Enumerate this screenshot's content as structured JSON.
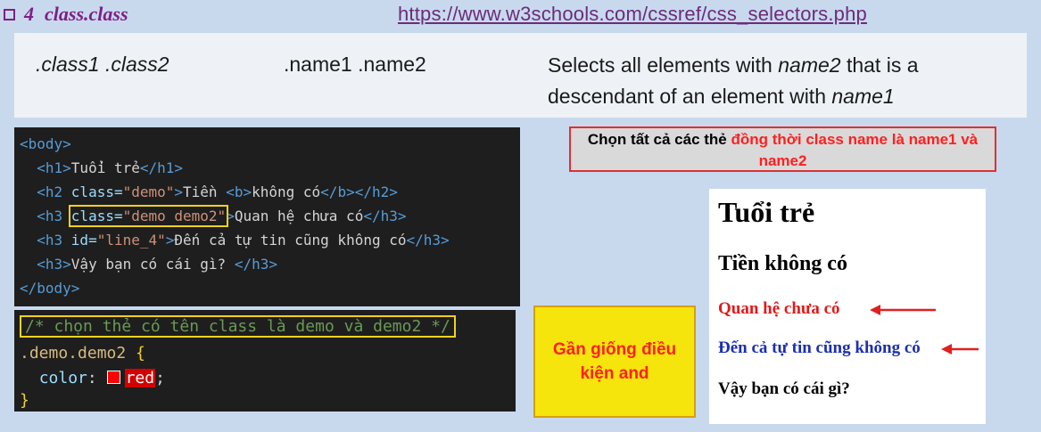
{
  "heading": {
    "number": "4",
    "title": "class.class"
  },
  "url": "https://www.w3schools.com/cssref/css_selectors.php",
  "reference": {
    "selector": ".class1 .class2",
    "example": ".name1 .name2",
    "description_parts": [
      "Selects all elements with ",
      "name2",
      " that is a descendant of an element with ",
      "name1"
    ]
  },
  "html_code": {
    "body_open": "<body>",
    "h1": {
      "open": "<h1>",
      "text": "Tuổi trẻ",
      "close": "</h1>"
    },
    "h2": {
      "open": "<h2 ",
      "attr": "class=",
      "value": "\"demo\"",
      "gt": ">",
      "text": "Tiền ",
      "b_open": "<b>",
      "b_text": "không có",
      "b_close": "</b>",
      "close": "</h2>"
    },
    "h3a": {
      "open": "<h3 ",
      "attr": "class=",
      "value": "\"demo demo2\"",
      "gt": ">",
      "text": "Quan hệ chưa có",
      "close": "</h3>"
    },
    "h3b": {
      "open": "<h3 ",
      "attr": "id=",
      "value": "\"line_4\"",
      "gt": ">",
      "text": "Đến cả tự tin cũng không có",
      "close": "</h3>"
    },
    "h3c": {
      "open": "<h3>",
      "text": "Vậy bạn có cái gì? ",
      "close": "</h3>"
    },
    "body_close": "</body>"
  },
  "css_code": {
    "comment": "/* chọn thẻ có tên class là demo và demo2 */",
    "selector": ".demo.demo2 ",
    "open_brace": "{",
    "property": "color",
    "colon": ": ",
    "value": "red",
    "semicolon": ";",
    "close_brace": "}",
    "swatch_color": "#ff0000"
  },
  "note_top": {
    "black": "Chọn tất cả các thẻ ",
    "red": "đồng thời class name là name1 và name2"
  },
  "note_yellow": "Gần giống điều kiện and",
  "preview": {
    "h1": "Tuổi trẻ",
    "h2": "Tiền không có",
    "h3_red": "Quan hệ chưa có",
    "h3_blue": "Đến cả tự tin cũng không có",
    "h3_black": "Vậy bạn có cái gì?"
  },
  "colors": {
    "accent_purple": "#7e1f86",
    "highlight_yellow": "#f2d21b",
    "arrow_red": "#e02020",
    "preview_red": "#e01b1b",
    "preview_blue": "#1b2fb0"
  }
}
